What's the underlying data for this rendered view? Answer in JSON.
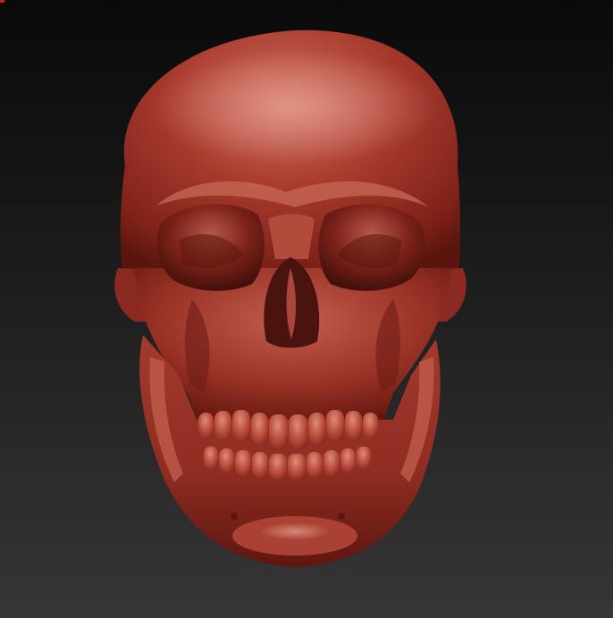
{
  "viewport": {
    "background_top": "#0a0a0a",
    "background_bottom": "#363636",
    "marker_color": "#c81e1e"
  },
  "model": {
    "subject": "skull-model",
    "material_color": "#a3362b",
    "highlight_color": "#d27363",
    "shadow_color": "#4a130e"
  }
}
